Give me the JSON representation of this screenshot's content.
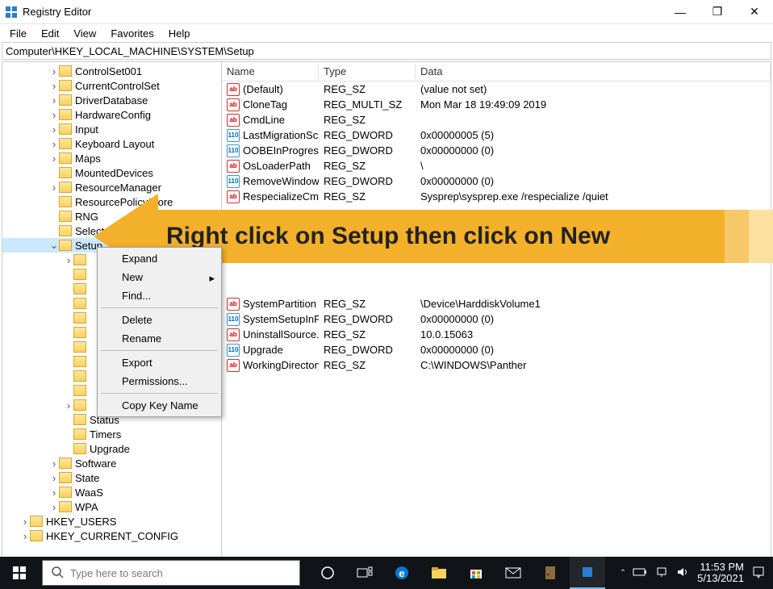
{
  "window": {
    "title": "Registry Editor"
  },
  "menubar": [
    "File",
    "Edit",
    "View",
    "Favorites",
    "Help"
  ],
  "addressbar": "Computer\\HKEY_LOCAL_MACHINE\\SYSTEM\\Setup",
  "tree": [
    {
      "name": "ControlSet001",
      "indent": 3,
      "exp": "›"
    },
    {
      "name": "CurrentControlSet",
      "indent": 3,
      "exp": "›"
    },
    {
      "name": "DriverDatabase",
      "indent": 3,
      "exp": "›"
    },
    {
      "name": "HardwareConfig",
      "indent": 3,
      "exp": "›"
    },
    {
      "name": "Input",
      "indent": 3,
      "exp": "›"
    },
    {
      "name": "Keyboard Layout",
      "indent": 3,
      "exp": "›"
    },
    {
      "name": "Maps",
      "indent": 3,
      "exp": "›"
    },
    {
      "name": "MountedDevices",
      "indent": 3,
      "exp": ""
    },
    {
      "name": "ResourceManager",
      "indent": 3,
      "exp": "›"
    },
    {
      "name": "ResourcePolicyStore",
      "indent": 3,
      "exp": ""
    },
    {
      "name": "RNG",
      "indent": 3,
      "exp": ""
    },
    {
      "name": "Select",
      "indent": 3,
      "exp": ""
    },
    {
      "name": "Setup",
      "indent": 3,
      "exp": "⌄",
      "selected": true
    },
    {
      "name": "",
      "indent": 4,
      "exp": "›"
    },
    {
      "name": "",
      "indent": 4,
      "exp": ""
    },
    {
      "name": "",
      "indent": 4,
      "exp": ""
    },
    {
      "name": "",
      "indent": 4,
      "exp": ""
    },
    {
      "name": "",
      "indent": 4,
      "exp": ""
    },
    {
      "name": "",
      "indent": 4,
      "exp": ""
    },
    {
      "name": "",
      "indent": 4,
      "exp": ""
    },
    {
      "name": "",
      "indent": 4,
      "exp": ""
    },
    {
      "name": "",
      "indent": 4,
      "exp": ""
    },
    {
      "name": "",
      "indent": 4,
      "exp": ""
    },
    {
      "name": "",
      "indent": 4,
      "exp": "›"
    },
    {
      "name": "Status",
      "indent": 4,
      "exp": ""
    },
    {
      "name": "Timers",
      "indent": 4,
      "exp": ""
    },
    {
      "name": "Upgrade",
      "indent": 4,
      "exp": ""
    },
    {
      "name": "Software",
      "indent": 3,
      "exp": "›"
    },
    {
      "name": "State",
      "indent": 3,
      "exp": "›"
    },
    {
      "name": "WaaS",
      "indent": 3,
      "exp": "›"
    },
    {
      "name": "WPA",
      "indent": 3,
      "exp": "›"
    },
    {
      "name": "HKEY_USERS",
      "indent": 1,
      "exp": "›"
    },
    {
      "name": "HKEY_CURRENT_CONFIG",
      "indent": 1,
      "exp": "›"
    }
  ],
  "columns": {
    "name": "Name",
    "type": "Type",
    "data": "Data"
  },
  "values": [
    {
      "icon": "ab",
      "name": "(Default)",
      "type": "REG_SZ",
      "data": "(value not set)"
    },
    {
      "icon": "ab",
      "name": "CloneTag",
      "type": "REG_MULTI_SZ",
      "data": "Mon Mar 18 19:49:09 2019"
    },
    {
      "icon": "ab",
      "name": "CmdLine",
      "type": "REG_SZ",
      "data": ""
    },
    {
      "icon": "bin",
      "name": "LastMigrationSc...",
      "type": "REG_DWORD",
      "data": "0x00000005 (5)"
    },
    {
      "icon": "bin",
      "name": "OOBEInProgress",
      "type": "REG_DWORD",
      "data": "0x00000000 (0)"
    },
    {
      "icon": "ab",
      "name": "OsLoaderPath",
      "type": "REG_SZ",
      "data": "\\"
    },
    {
      "icon": "bin",
      "name": "RemoveWindow...",
      "type": "REG_DWORD",
      "data": "0x00000000 (0)"
    },
    {
      "icon": "ab",
      "name": "RespecializeCm...",
      "type": "REG_SZ",
      "data": "Sysprep\\sysprep.exe /respecialize /quiet"
    },
    {
      "icon": "hidden",
      "name": "",
      "type": "",
      "data": ""
    },
    {
      "icon": "hidden",
      "name": "",
      "type": "",
      "data": ""
    },
    {
      "icon": "hidden",
      "name": "",
      "type": "",
      "data": ""
    },
    {
      "icon": "hidden",
      "name": "",
      "type": "",
      "data": ""
    },
    {
      "icon": "hidden",
      "name": "",
      "type": "",
      "data": ""
    },
    {
      "icon": "hidden",
      "name": "",
      "type": "",
      "data": ""
    },
    {
      "icon": "ab",
      "name": "SystemPartition",
      "type": "REG_SZ",
      "data": "\\Device\\HarddiskVolume1"
    },
    {
      "icon": "bin",
      "name": "SystemSetupInP...",
      "type": "REG_DWORD",
      "data": "0x00000000 (0)"
    },
    {
      "icon": "ab",
      "name": "UninstallSource...",
      "type": "REG_SZ",
      "data": "10.0.15063"
    },
    {
      "icon": "bin",
      "name": "Upgrade",
      "type": "REG_DWORD",
      "data": "0x00000000 (0)"
    },
    {
      "icon": "ab",
      "name": "WorkingDirectory",
      "type": "REG_SZ",
      "data": "C:\\WINDOWS\\Panther"
    }
  ],
  "contextmenu": {
    "items": [
      {
        "label": "Expand"
      },
      {
        "label": "New",
        "submenu": true
      },
      {
        "label": "Find..."
      },
      {
        "sep": true
      },
      {
        "label": "Delete"
      },
      {
        "label": "Rename"
      },
      {
        "sep": true
      },
      {
        "label": "Export"
      },
      {
        "label": "Permissions..."
      },
      {
        "sep": true
      },
      {
        "label": "Copy Key Name"
      }
    ]
  },
  "annotation": "Right click on Setup then click on New",
  "taskbar": {
    "search_placeholder": "Type here to search",
    "time": "11:53 PM",
    "date": "5/13/2021"
  }
}
